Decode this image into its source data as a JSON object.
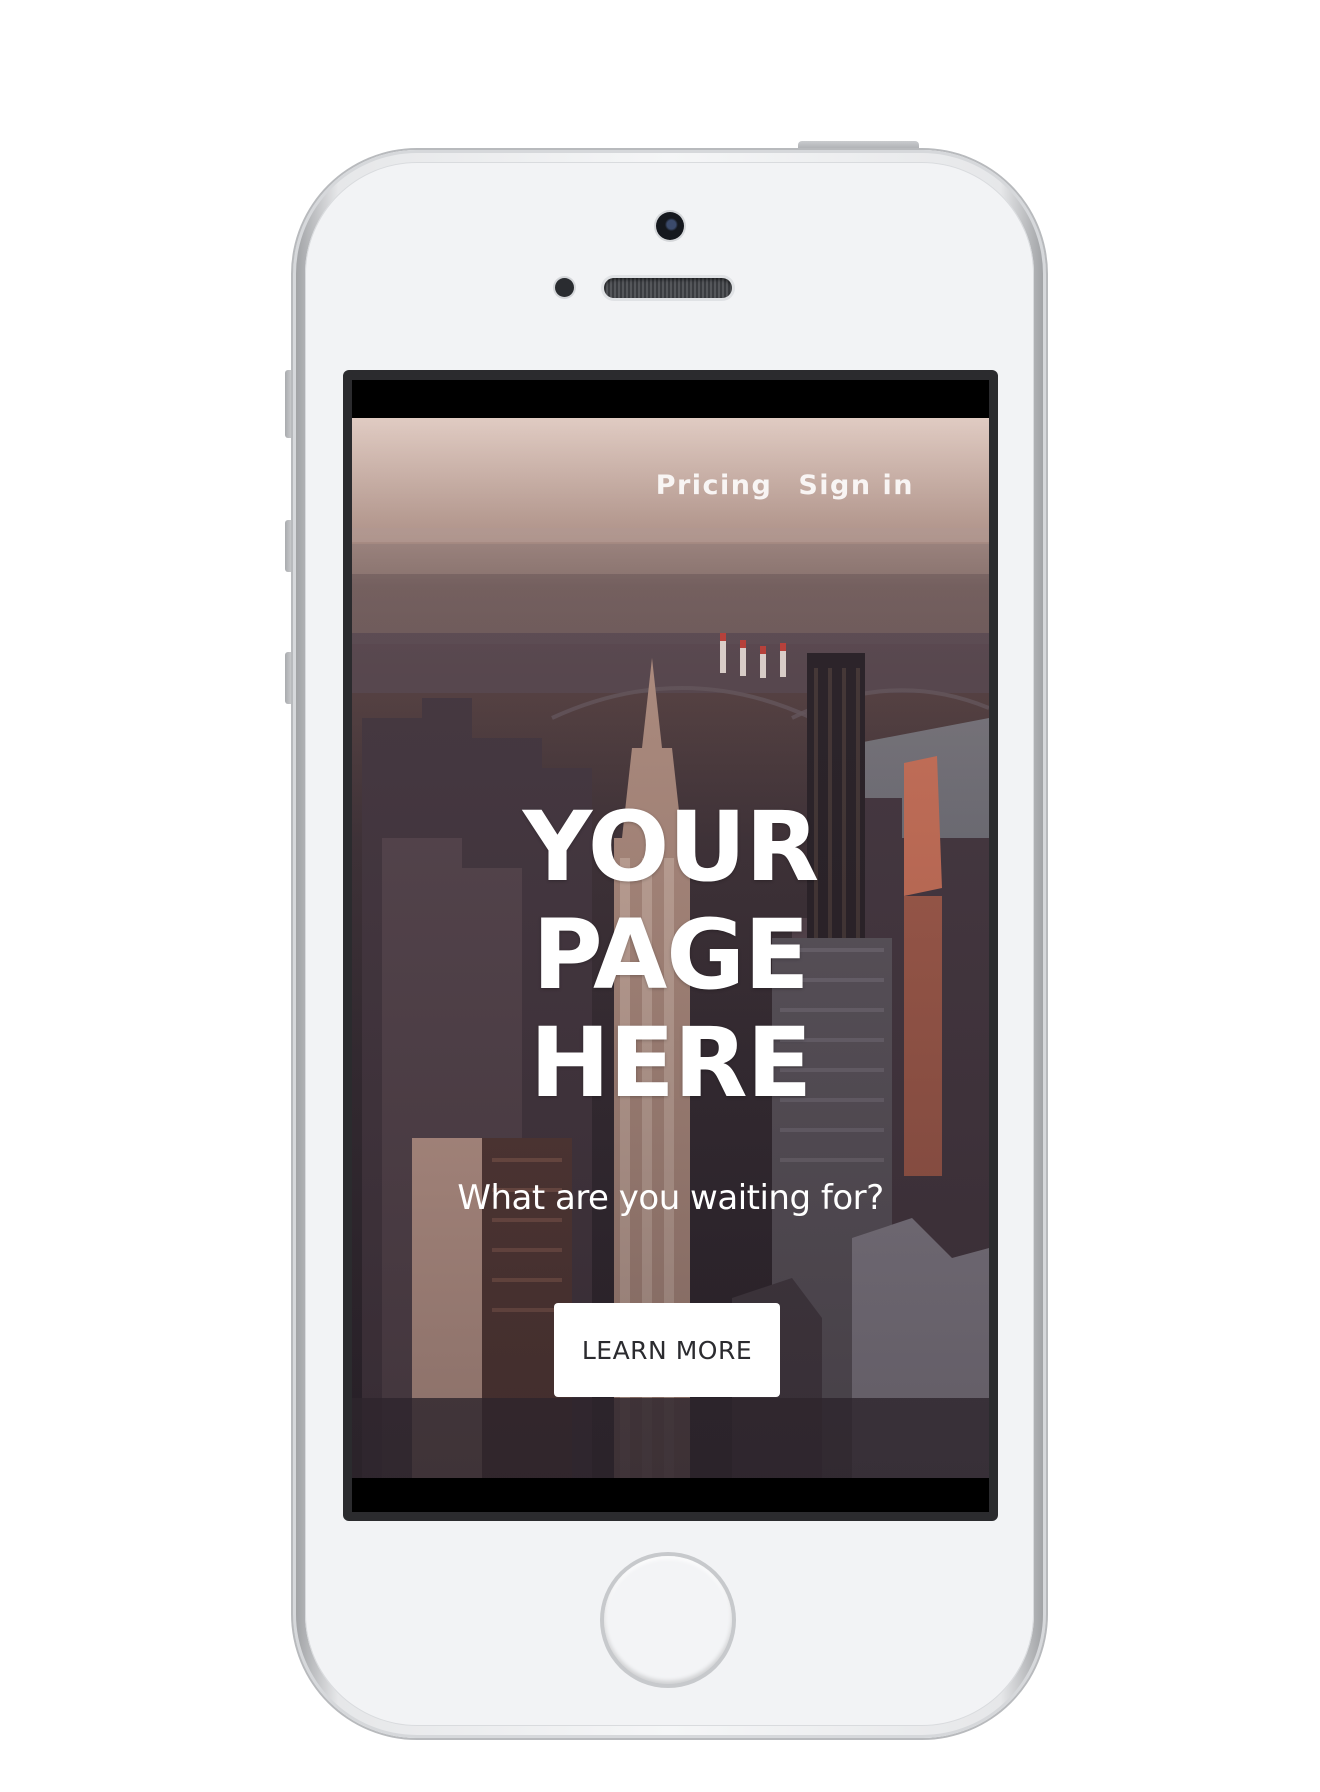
{
  "nav": {
    "items": [
      {
        "label": "Pricing"
      },
      {
        "label": "Sign in"
      }
    ]
  },
  "hero": {
    "headline": [
      "YOUR",
      "PAGE",
      "HERE"
    ],
    "subtitle": "What are you waiting for?",
    "cta_label": "LEARN MORE"
  },
  "colors": {
    "phone_body": "#f2f3f5",
    "screen_frame": "#2b2b2e",
    "cta_background": "#ffffff",
    "cta_text": "#2b2b2f",
    "hero_text": "#ffffff"
  },
  "icons": [
    "front-camera-icon",
    "proximity-sensor-icon",
    "earpiece-speaker-icon",
    "home-button-icon"
  ]
}
